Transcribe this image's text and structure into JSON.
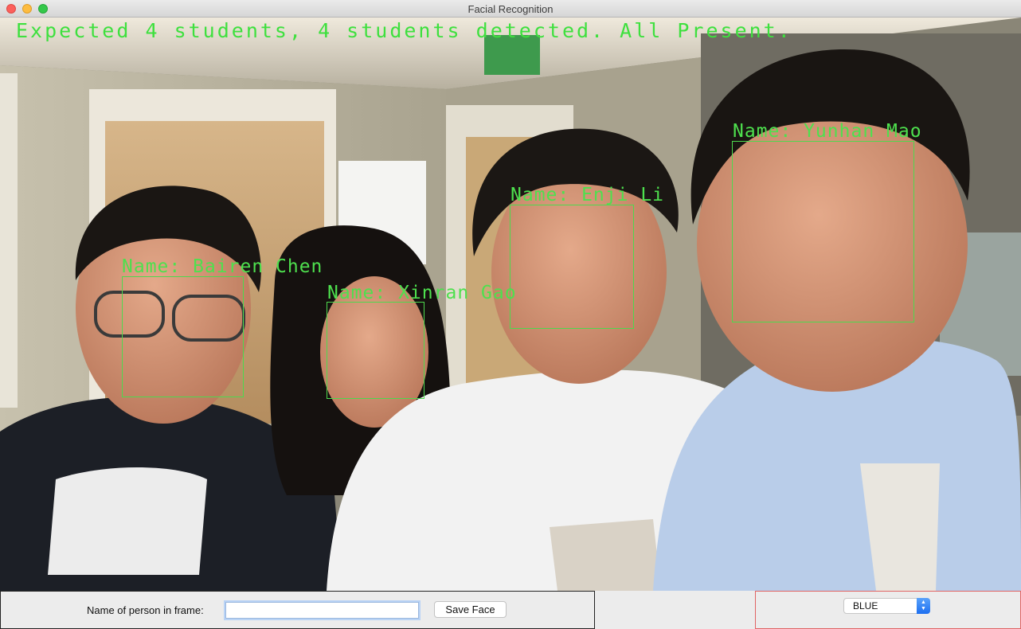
{
  "window": {
    "title": "Facial Recognition"
  },
  "video": {
    "status_text": "Expected 4 students, 4 students detected. All Present.",
    "faces": [
      {
        "label": "Name: Bairen Chen"
      },
      {
        "label": "Name: Xinran Gao"
      },
      {
        "label": "Name: Enji Li"
      },
      {
        "label": "Name: Yunhan Mao"
      }
    ]
  },
  "controls": {
    "name_label": "Name of person in frame:",
    "name_input_value": "",
    "save_button": "Save Face",
    "color_select_value": "BLUE"
  },
  "colors": {
    "overlay_green": "#4ee04e",
    "left_panel_border": "#222222",
    "right_panel_border": "#e06464"
  }
}
